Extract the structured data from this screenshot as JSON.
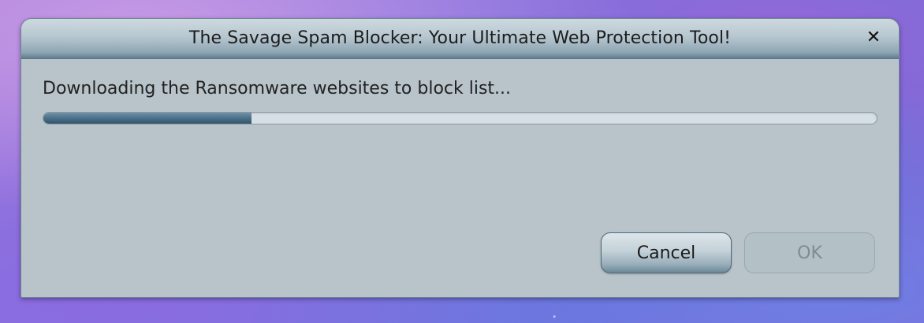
{
  "dialog": {
    "title": "The Savage Spam Blocker: Your Ultimate Web Protection Tool!",
    "close_icon": "close-icon",
    "close_glyph": "✕",
    "message": "Downloading the Ransomware websites to block list...",
    "progress_fraction": 0.25,
    "buttons": {
      "cancel_label": "Cancel",
      "ok_label": "OK",
      "ok_enabled": false
    }
  }
}
